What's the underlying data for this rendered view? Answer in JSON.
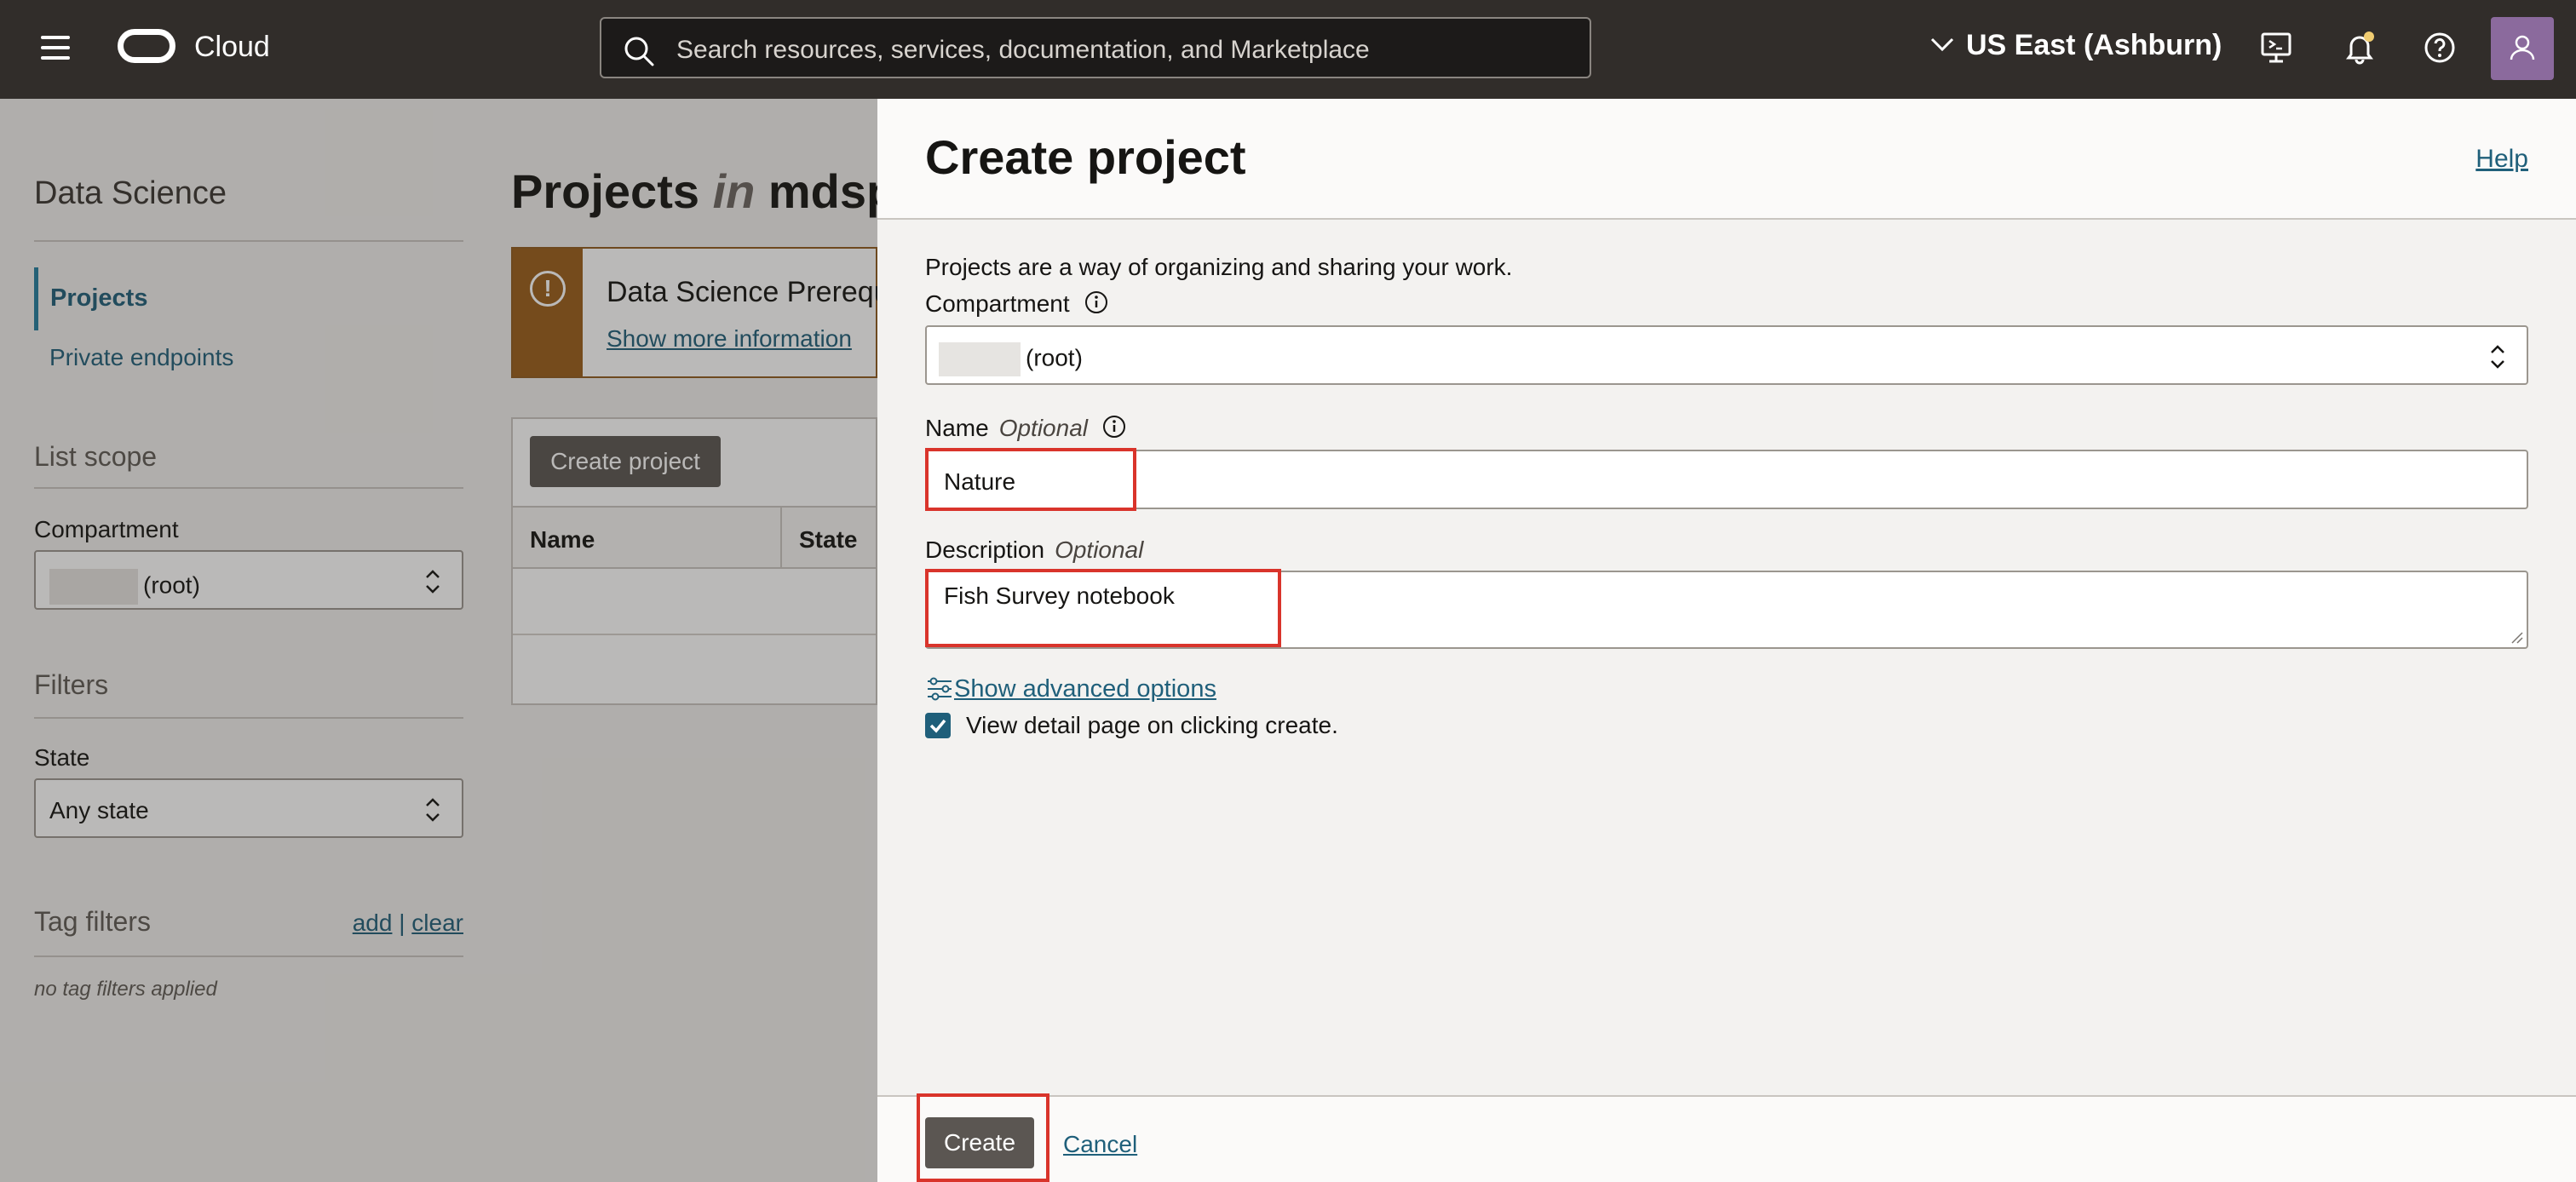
{
  "topbar": {
    "brand": "Cloud",
    "search_placeholder": "Search resources, services, documentation, and Marketplace",
    "region": "US East (Ashburn)"
  },
  "sidebar": {
    "title": "Data Science",
    "nav": [
      {
        "label": "Projects",
        "active": true
      },
      {
        "label": "Private endpoints",
        "active": false
      }
    ],
    "list_scope": {
      "title": "List scope",
      "compartment_label": "Compartment",
      "compartment_value": "(root)"
    },
    "filters": {
      "title": "Filters",
      "state_label": "State",
      "state_value": "Any state"
    },
    "tag_filters": {
      "title": "Tag filters",
      "add": "add",
      "separator": "|",
      "clear": "clear",
      "empty": "no tag filters applied"
    }
  },
  "main": {
    "title_prefix": "Projects",
    "title_in": "in",
    "title_suffix": "mdspr",
    "alert": {
      "title": "Data Science Prerequ",
      "link": "Show more information"
    },
    "create_button": "Create project",
    "columns": [
      "Name",
      "State"
    ]
  },
  "drawer": {
    "title": "Create project",
    "help": "Help",
    "intro": "Projects are a way of organizing and sharing your work.",
    "compartment": {
      "label": "Compartment",
      "value": "(root)"
    },
    "name": {
      "label": "Name",
      "optional": "Optional",
      "value": "Nature"
    },
    "description": {
      "label": "Description",
      "optional": "Optional",
      "value": "Fish Survey notebook"
    },
    "advanced": "Show advanced options",
    "checkbox": {
      "label": "View detail page on clicking create.",
      "checked": true
    },
    "create": "Create",
    "cancel": "Cancel"
  },
  "colors": {
    "topbar": "#312d2a",
    "link": "#1f5f7a",
    "highlight": "#d9342b",
    "alert": "#9a5e1a",
    "button": "#5b5652"
  }
}
